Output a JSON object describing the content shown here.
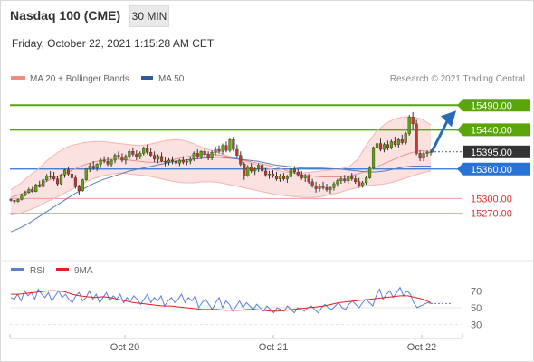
{
  "header": {
    "title": "Nasdaq 100 (CME)",
    "timeframe": "30 MIN",
    "datetime": "Friday, October 22, 2021 1:15:28 AM CET"
  },
  "legend": {
    "items": [
      {
        "label": "MA 20 + Bollinger Bands",
        "color": "#f28b82"
      },
      {
        "label": "MA 50",
        "color": "#2f5c9e"
      }
    ],
    "source": "Research © 2021 Trading Central"
  },
  "chart_data": [
    {
      "type": "candlestick",
      "ylim": [
        15225,
        15520
      ],
      "x_ticks": [
        "Oct 20",
        "Oct 21",
        "Oct 22"
      ],
      "levels": [
        {
          "value": 15490,
          "label": "15490.00",
          "kind": "target",
          "color": "#5aa60a"
        },
        {
          "value": 15440,
          "label": "15440.00",
          "kind": "target",
          "color": "#5aa60a"
        },
        {
          "value": 15395,
          "label": "15395.00",
          "kind": "last",
          "color": "#333333"
        },
        {
          "value": 15360,
          "label": "15360.00",
          "kind": "pivot",
          "color": "#2a73d6"
        },
        {
          "value": 15300,
          "label": "15300.00",
          "kind": "support",
          "color": "#e03030"
        },
        {
          "value": 15270,
          "label": "15270.00",
          "kind": "support",
          "color": "#e03030"
        }
      ],
      "candles": [
        [
          15298,
          15300,
          15294,
          15296
        ],
        [
          15296,
          15297,
          15290,
          15294
        ],
        [
          15294,
          15300,
          15292,
          15298
        ],
        [
          15298,
          15310,
          15296,
          15308
        ],
        [
          15308,
          15316,
          15304,
          15312
        ],
        [
          15312,
          15322,
          15310,
          15318
        ],
        [
          15318,
          15324,
          15312,
          15314
        ],
        [
          15314,
          15330,
          15313,
          15328
        ],
        [
          15328,
          15336,
          15322,
          15324
        ],
        [
          15324,
          15340,
          15322,
          15338
        ],
        [
          15338,
          15350,
          15334,
          15346
        ],
        [
          15346,
          15356,
          15340,
          15344
        ],
        [
          15344,
          15354,
          15336,
          15340
        ],
        [
          15340,
          15346,
          15326,
          15330
        ],
        [
          15330,
          15350,
          15328,
          15348
        ],
        [
          15348,
          15360,
          15342,
          15358
        ],
        [
          15358,
          15364,
          15346,
          15350
        ],
        [
          15350,
          15356,
          15338,
          15342
        ],
        [
          15342,
          15348,
          15320,
          15324
        ],
        [
          15324,
          15328,
          15308,
          15316
        ],
        [
          15316,
          15340,
          15314,
          15338
        ],
        [
          15338,
          15362,
          15336,
          15360
        ],
        [
          15360,
          15372,
          15354,
          15366
        ],
        [
          15366,
          15376,
          15358,
          15362
        ],
        [
          15362,
          15372,
          15356,
          15370
        ],
        [
          15370,
          15382,
          15362,
          15378
        ],
        [
          15378,
          15386,
          15372,
          15376
        ],
        [
          15376,
          15384,
          15366,
          15370
        ],
        [
          15370,
          15380,
          15364,
          15378
        ],
        [
          15378,
          15392,
          15372,
          15388
        ],
        [
          15388,
          15396,
          15380,
          15384
        ],
        [
          15384,
          15392,
          15374,
          15378
        ],
        [
          15378,
          15390,
          15370,
          15386
        ],
        [
          15386,
          15400,
          15380,
          15396
        ],
        [
          15396,
          15404,
          15386,
          15390
        ],
        [
          15390,
          15398,
          15378,
          15384
        ],
        [
          15384,
          15396,
          15380,
          15392
        ],
        [
          15392,
          15406,
          15388,
          15402
        ],
        [
          15402,
          15410,
          15390,
          15394
        ],
        [
          15394,
          15402,
          15384,
          15388
        ],
        [
          15388,
          15396,
          15374,
          15380
        ],
        [
          15380,
          15390,
          15372,
          15386
        ],
        [
          15386,
          15394,
          15374,
          15376
        ],
        [
          15376,
          15384,
          15366,
          15374
        ],
        [
          15374,
          15382,
          15368,
          15378
        ],
        [
          15378,
          15386,
          15370,
          15376
        ],
        [
          15376,
          15382,
          15368,
          15372
        ],
        [
          15372,
          15380,
          15366,
          15378
        ],
        [
          15378,
          15386,
          15370,
          15374
        ],
        [
          15374,
          15380,
          15368,
          15376
        ],
        [
          15376,
          15384,
          15370,
          15380
        ],
        [
          15380,
          15396,
          15376,
          15392
        ],
        [
          15392,
          15400,
          15380,
          15384
        ],
        [
          15384,
          15398,
          15380,
          15396
        ],
        [
          15396,
          15404,
          15386,
          15390
        ],
        [
          15390,
          15396,
          15378,
          15382
        ],
        [
          15382,
          15398,
          15378,
          15394
        ],
        [
          15394,
          15406,
          15388,
          15400
        ],
        [
          15400,
          15408,
          15392,
          15396
        ],
        [
          15396,
          15412,
          15390,
          15408
        ],
        [
          15408,
          15416,
          15394,
          15398
        ],
        [
          15398,
          15424,
          15394,
          15420
        ],
        [
          15420,
          15426,
          15396,
          15400
        ],
        [
          15400,
          15410,
          15382,
          15388
        ],
        [
          15388,
          15396,
          15366,
          15370
        ],
        [
          15370,
          15374,
          15338,
          15346
        ],
        [
          15346,
          15368,
          15344,
          15364
        ],
        [
          15364,
          15372,
          15352,
          15356
        ],
        [
          15356,
          15364,
          15348,
          15360
        ],
        [
          15360,
          15372,
          15354,
          15368
        ],
        [
          15368,
          15374,
          15352,
          15356
        ],
        [
          15356,
          15362,
          15344,
          15348
        ],
        [
          15348,
          15356,
          15340,
          15350
        ],
        [
          15350,
          15358,
          15342,
          15346
        ],
        [
          15346,
          15354,
          15336,
          15340
        ],
        [
          15340,
          15350,
          15334,
          15346
        ],
        [
          15346,
          15352,
          15336,
          15340
        ],
        [
          15340,
          15348,
          15332,
          15344
        ],
        [
          15344,
          15364,
          15342,
          15360
        ],
        [
          15360,
          15366,
          15350,
          15354
        ],
        [
          15354,
          15360,
          15344,
          15348
        ],
        [
          15348,
          15356,
          15338,
          15342
        ],
        [
          15342,
          15350,
          15334,
          15346
        ],
        [
          15346,
          15350,
          15330,
          15334
        ],
        [
          15334,
          15340,
          15322,
          15326
        ],
        [
          15326,
          15334,
          15312,
          15320
        ],
        [
          15320,
          15330,
          15314,
          15326
        ],
        [
          15326,
          15334,
          15318,
          15322
        ],
        [
          15322,
          15330,
          15314,
          15318
        ],
        [
          15318,
          15326,
          15310,
          15322
        ],
        [
          15322,
          15334,
          15316,
          15330
        ],
        [
          15330,
          15340,
          15324,
          15336
        ],
        [
          15336,
          15344,
          15330,
          15340
        ],
        [
          15340,
          15348,
          15332,
          15336
        ],
        [
          15336,
          15346,
          15330,
          15344
        ],
        [
          15344,
          15352,
          15336,
          15340
        ],
        [
          15340,
          15348,
          15330,
          15334
        ],
        [
          15334,
          15342,
          15322,
          15326
        ],
        [
          15326,
          15336,
          15322,
          15332
        ],
        [
          15332,
          15346,
          15328,
          15342
        ],
        [
          15342,
          15366,
          15340,
          15362
        ],
        [
          15362,
          15406,
          15360,
          15404
        ],
        [
          15404,
          15420,
          15396,
          15412
        ],
        [
          15412,
          15422,
          15396,
          15400
        ],
        [
          15400,
          15414,
          15394,
          15410
        ],
        [
          15410,
          15418,
          15398,
          15404
        ],
        [
          15404,
          15420,
          15400,
          15416
        ],
        [
          15416,
          15426,
          15406,
          15410
        ],
        [
          15410,
          15424,
          15404,
          15420
        ],
        [
          15420,
          15430,
          15410,
          15414
        ],
        [
          15414,
          15436,
          15410,
          15432
        ],
        [
          15432,
          15470,
          15428,
          15466
        ],
        [
          15466,
          15476,
          15440,
          15452
        ],
        [
          15452,
          15460,
          15388,
          15392
        ],
        [
          15392,
          15398,
          15376,
          15382
        ],
        [
          15382,
          15396,
          15376,
          15392
        ],
        [
          15392,
          15398,
          15384,
          15394
        ],
        [
          15394,
          15400,
          15388,
          15395
        ]
      ],
      "ma20": [
        15302,
        15308,
        15316,
        15326,
        15336,
        15344,
        15352,
        15360,
        15368,
        15374,
        15378,
        15380,
        15380,
        15378,
        15376,
        15374,
        15374,
        15376,
        15380,
        15384,
        15388,
        15390,
        15390,
        15388,
        15384,
        15380,
        15376,
        15372,
        15368,
        15364,
        15358,
        15352,
        15348,
        15346,
        15344,
        15344,
        15344,
        15346,
        15350,
        15356,
        15364,
        15372,
        15380,
        15388,
        15394,
        15398,
        15394
      ],
      "bb_upper": [
        15318,
        15330,
        15346,
        15360,
        15378,
        15392,
        15404,
        15410,
        15414,
        15416,
        15416,
        15414,
        15412,
        15410,
        15408,
        15410,
        15414,
        15418,
        15420,
        15418,
        15412,
        15404,
        15398,
        15392,
        15386,
        15380,
        15374,
        15368,
        15362,
        15358,
        15354,
        15352,
        15352,
        15354,
        15356,
        15358,
        15360,
        15364,
        15380,
        15410,
        15436,
        15452,
        15462,
        15466,
        15466,
        15462,
        15450
      ],
      "bb_lower": [
        15266,
        15270,
        15276,
        15284,
        15294,
        15302,
        15312,
        15322,
        15332,
        15340,
        15346,
        15350,
        15352,
        15350,
        15348,
        15346,
        15342,
        15338,
        15334,
        15332,
        15332,
        15334,
        15334,
        15332,
        15328,
        15324,
        15320,
        15316,
        15312,
        15308,
        15306,
        15304,
        15302,
        15302,
        15304,
        15308,
        15312,
        15318,
        15322,
        15326,
        15328,
        15330,
        15334,
        15340,
        15346,
        15352,
        15356
      ],
      "ma50": [
        15232,
        15240,
        15250,
        15262,
        15274,
        15286,
        15298,
        15310,
        15320,
        15330,
        15338,
        15344,
        15350,
        15356,
        15360,
        15364,
        15368,
        15372,
        15376,
        15378,
        15380,
        15382,
        15384,
        15384,
        15382,
        15380,
        15378,
        15376,
        15372,
        15368,
        15366,
        15364,
        15362,
        15362,
        15362,
        15361,
        15360,
        15358,
        15356,
        15354,
        15354,
        15356,
        15360,
        15364,
        15366,
        15366,
        15366
      ]
    },
    {
      "type": "line",
      "ylim": [
        20,
        80
      ],
      "y_ticks": [
        70,
        50,
        30
      ],
      "legend": [
        {
          "label": "RSI",
          "color": "#5b7fd6"
        },
        {
          "label": "9MA",
          "color": "#e02020"
        }
      ],
      "series": [
        {
          "name": "RSI",
          "values": [
            62,
            60,
            66,
            58,
            70,
            64,
            68,
            60,
            72,
            66,
            62,
            68,
            58,
            64,
            70,
            62,
            66,
            60,
            56,
            64,
            68,
            58,
            62,
            70,
            60,
            66,
            56,
            62,
            68,
            58,
            64,
            60,
            66,
            56,
            62,
            58,
            64,
            60,
            54,
            60,
            66,
            56,
            62,
            58,
            64,
            52,
            58,
            62,
            56,
            60,
            66,
            56,
            62,
            58,
            64,
            50,
            56,
            60,
            54,
            48,
            56,
            62,
            50,
            58,
            54,
            46,
            52,
            58,
            50,
            56,
            52,
            48,
            54,
            50,
            46,
            52,
            48,
            44,
            50,
            48,
            46,
            52,
            48,
            44,
            50,
            48,
            46,
            50,
            52,
            48,
            44,
            50,
            54,
            50,
            48,
            52,
            56,
            50,
            48,
            54,
            58,
            54,
            50,
            56,
            60,
            56,
            52,
            64,
            72,
            60,
            66,
            70,
            62,
            68,
            74,
            64,
            70,
            66,
            56,
            50,
            52,
            54,
            56,
            55
          ]
        },
        {
          "name": "9MA",
          "values": [
            66,
            66,
            67,
            68,
            69,
            70,
            70,
            69,
            66,
            64,
            63,
            62,
            63,
            62,
            60,
            58,
            56,
            55,
            54,
            53,
            52,
            52,
            51,
            50,
            49,
            48,
            48,
            48,
            47,
            47,
            47,
            48,
            48,
            47,
            46,
            46,
            47,
            48,
            49,
            50,
            51,
            52,
            54,
            56,
            57,
            58,
            59,
            60,
            61,
            62,
            63,
            64,
            64,
            62,
            60,
            56
          ]
        }
      ]
    }
  ]
}
